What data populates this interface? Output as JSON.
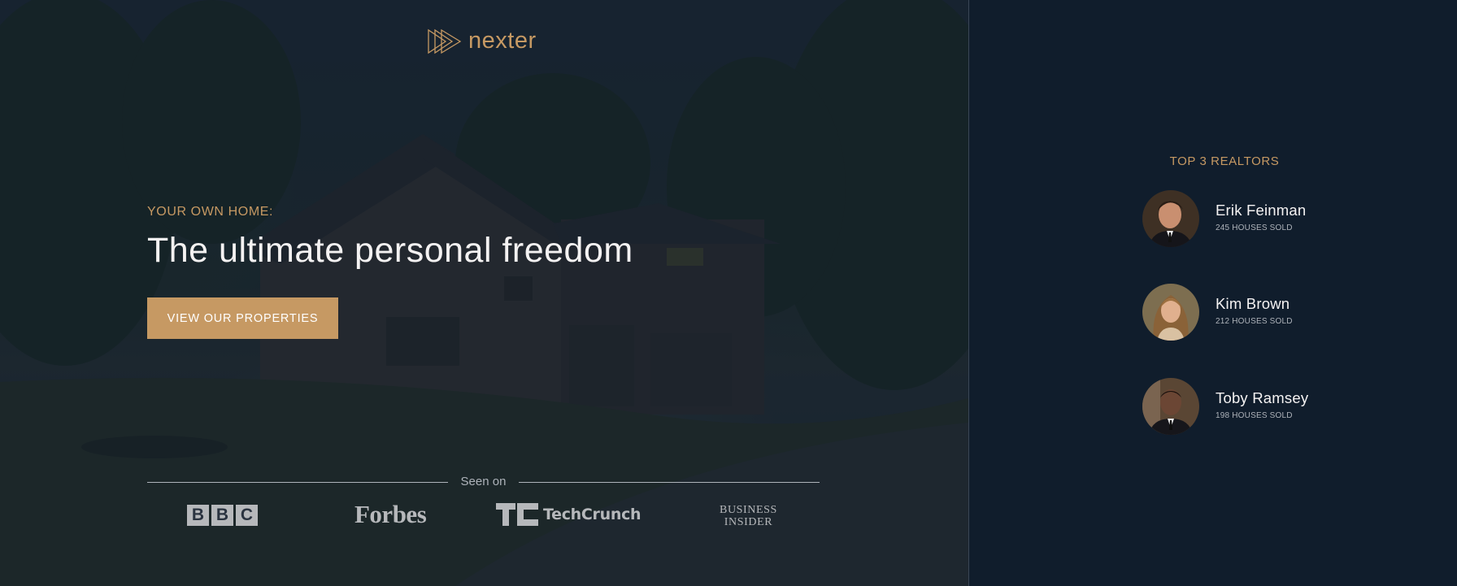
{
  "brand": {
    "name": "nexter",
    "accent_color": "#c69963",
    "dark_color": "#101d2c"
  },
  "hero": {
    "subtitle": "YOUR OWN HOME:",
    "title": "The ultimate personal freedom",
    "cta_label": "VIEW OUR PROPERTIES",
    "background_icon": "house-photo"
  },
  "seen_on": {
    "label": "Seen on",
    "logos": [
      {
        "name": "bbc-logo",
        "letters": [
          "B",
          "B",
          "C"
        ]
      },
      {
        "name": "forbes-logo",
        "text": "Forbes"
      },
      {
        "name": "techcrunch-logo",
        "text": "TechCrunch"
      },
      {
        "name": "business-insider-logo",
        "line1": "BUSINESS",
        "line2": "INSIDER"
      }
    ]
  },
  "realtors": {
    "title": "TOP 3 REALTORS",
    "items": [
      {
        "name": "Erik Feinman",
        "sold": "245 HOUSES SOLD"
      },
      {
        "name": "Kim Brown",
        "sold": "212 HOUSES SOLD"
      },
      {
        "name": "Toby Ramsey",
        "sold": "198 HOUSES SOLD"
      }
    ]
  }
}
